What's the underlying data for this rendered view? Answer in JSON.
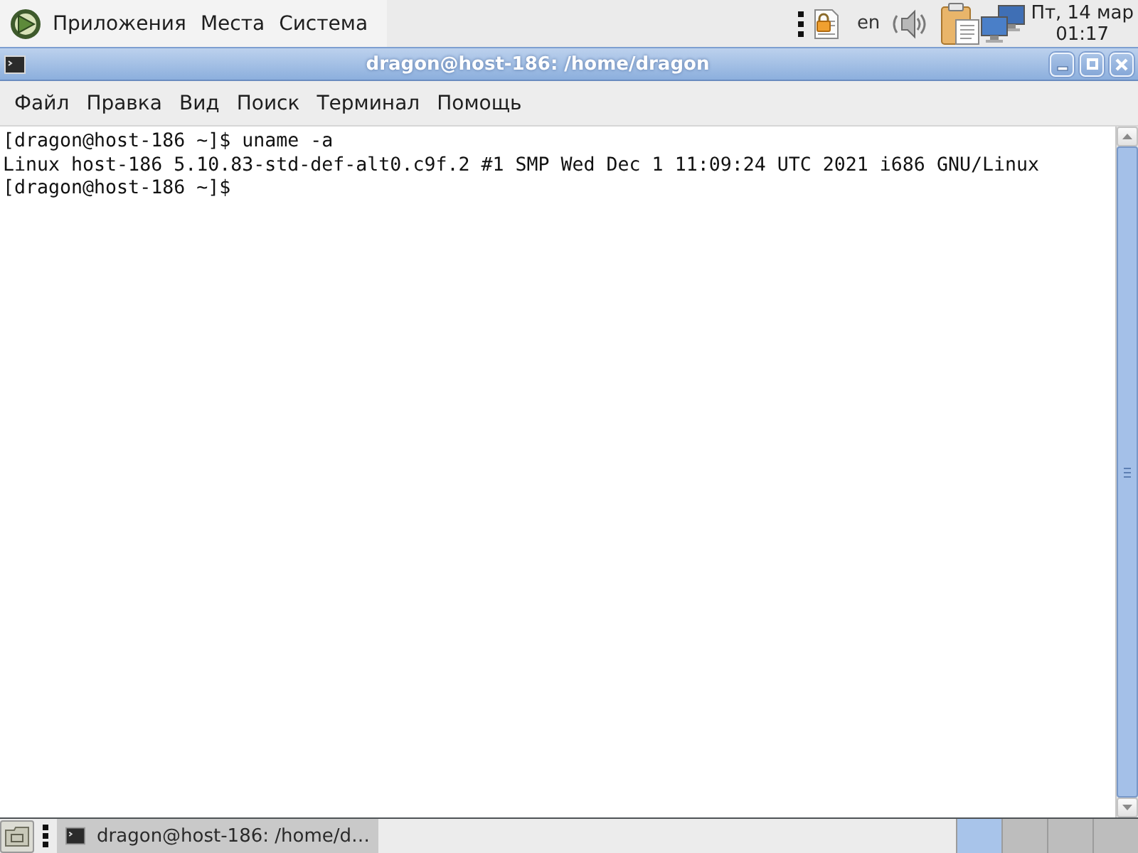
{
  "top_panel": {
    "menus": [
      "Приложения",
      "Места",
      "Система"
    ],
    "keyboard_layout": "en",
    "clock": {
      "date": "Пт, 14 мар",
      "time": "01:17"
    }
  },
  "window": {
    "title": "dragon@host-186: /home/dragon",
    "menu": [
      "Файл",
      "Правка",
      "Вид",
      "Поиск",
      "Терминал",
      "Помощь"
    ],
    "terminal_lines": [
      "[dragon@host-186 ~]$ uname -a",
      "Linux host-186 5.10.83-std-def-alt0.c9f.2 #1 SMP Wed Dec 1 11:09:24 UTC 2021 i686 GNU/Linux",
      "[dragon@host-186 ~]$"
    ]
  },
  "bottom_panel": {
    "tasks": [
      {
        "label": "dragon@host-186: /home/d…",
        "selected": true
      }
    ],
    "workspaces": [
      {
        "selected": true
      },
      {
        "selected": false
      },
      {
        "selected": false
      },
      {
        "selected": false
      }
    ]
  }
}
